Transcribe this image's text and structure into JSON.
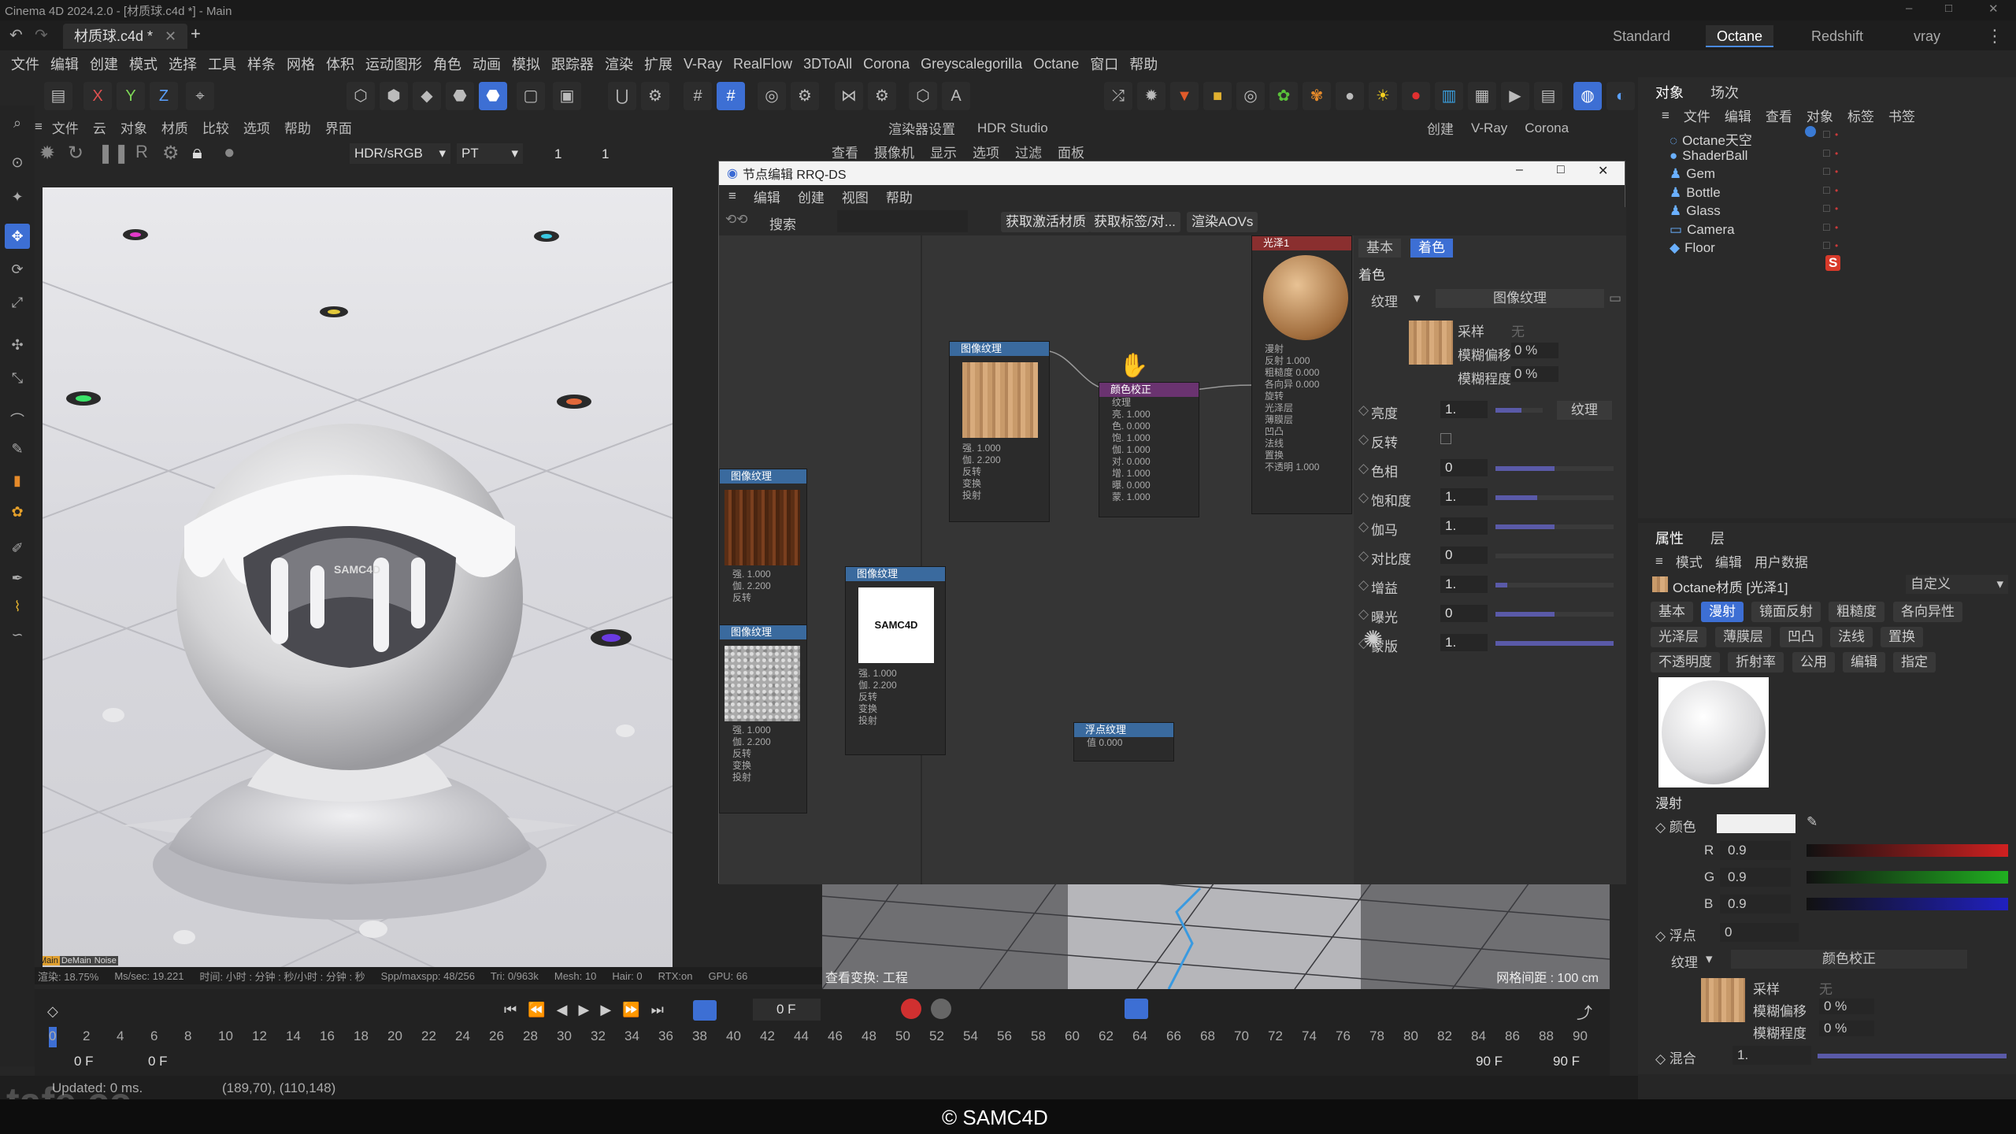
{
  "app": {
    "title": "Cinema 4D 2024.2.0 - [材质球.c4d *] - Main",
    "doc_tab": "材质球.c4d *",
    "add_tab": "+"
  },
  "layouts": [
    "Standard",
    "Octane",
    "Redshift",
    "vray"
  ],
  "menu": [
    "文件",
    "编辑",
    "创建",
    "模式",
    "选择",
    "工具",
    "样条",
    "网格",
    "体积",
    "运动图形",
    "角色",
    "动画",
    "模拟",
    "跟踪器",
    "渲染",
    "扩展",
    "V-Ray",
    "RealFlow",
    "3DToAll",
    "Corona",
    "Greyscalegorilla",
    "Octane",
    "窗口",
    "帮助"
  ],
  "toolbar_axes": [
    "X",
    "Y",
    "Z"
  ],
  "viewport": {
    "menu": [
      "文件",
      "云",
      "对象",
      "材质",
      "比较",
      "选项",
      "帮助",
      "界面"
    ],
    "color_space": "HDR/sRGB",
    "render_mode": "PT",
    "field1": "1",
    "field2": "1",
    "labels": [
      "Main",
      "DeMain",
      "Noise"
    ],
    "status": [
      "渲染: 18.75%",
      "Ms/sec: 19.221",
      "时间: 小时 : 分钟 : 秒/小时 : 分钟 : 秒",
      "Spp/maxspp: 48/256",
      "Tri: 0/963k",
      "Mesh: 10",
      "Hair: 0",
      "RTX:on",
      "GPU: 66"
    ],
    "logo_text": "SAMC4D"
  },
  "midmenu": {
    "left": [
      "渲染器设置",
      "HDR Studio"
    ],
    "right": [
      "创建",
      "V-Ray",
      "Corona"
    ],
    "view": [
      "查看",
      "摄像机",
      "显示",
      "选项",
      "过滤",
      "面板"
    ]
  },
  "node_editor": {
    "title": "节点编辑 RRQ-DS",
    "menu": [
      "编辑",
      "创建",
      "视图",
      "帮助"
    ],
    "search": "搜索",
    "buttons": [
      "获取激活材质",
      "获取标签/对...",
      "渲染AOVs"
    ],
    "nodes": {
      "img1": {
        "title": "图像纹理",
        "rows": [
          "强.  1.000",
          "伽.  2.200",
          "反转",
          "变换",
          "投射"
        ]
      },
      "img2": {
        "title": "图像纹理",
        "rows": [
          "强.  1.000",
          "伽.  2.200",
          "反转",
          "变换",
          "投射"
        ],
        "swatch_text": "SAMC4D"
      },
      "img3": {
        "title": "图像纹理",
        "rows": [
          "强.  1.000",
          "伽.  2.200",
          "反转"
        ]
      },
      "img4": {
        "title": "图像纹理",
        "rows": [
          "强.  1.000",
          "伽.  2.200",
          "反转",
          "变换",
          "投射"
        ]
      },
      "cc": {
        "title": "颜色校正",
        "rows": [
          "纹理",
          "亮.  1.000",
          "色.  0.000",
          "饱.  1.000",
          "伽.  1.000",
          "对.  0.000",
          "增.  1.000",
          "曝.  0.000",
          "蒙.  1.000"
        ]
      },
      "glossy": {
        "title": "光泽1",
        "rows": [
          "漫射",
          "反射  1.000",
          "粗糙度  0.000",
          "各向异  0.000",
          "旋转",
          "光泽层",
          "薄膜层",
          "凹凸",
          "法线",
          "置换",
          "不透明  1.000"
        ]
      },
      "float": {
        "title": "浮点纹理",
        "rows": [
          "值  0.000"
        ]
      }
    },
    "inspector": {
      "tabs": [
        "基本",
        "着色"
      ],
      "section": "着色",
      "texture_label": "纹理",
      "texture_value": "图像纹理",
      "sampling": "采样",
      "sampling_val": "无",
      "blur_offset": "模糊偏移",
      "blur_offset_val": "0 %",
      "blur_degree": "模糊程度",
      "blur_degree_val": "0 %",
      "params": [
        {
          "label": "亮度",
          "value": "1.",
          "fill": 0.55
        },
        {
          "label": "反转",
          "value": "",
          "fill": 0
        },
        {
          "label": "色相",
          "value": "0",
          "fill": 0.5
        },
        {
          "label": "饱和度",
          "value": "1.",
          "fill": 0.35
        },
        {
          "label": "伽马",
          "value": "1.",
          "fill": 0.5
        },
        {
          "label": "对比度",
          "value": "0",
          "fill": 0.0
        },
        {
          "label": "增益",
          "value": "1.",
          "fill": 0.1
        },
        {
          "label": "曝光",
          "value": "0",
          "fill": 0.5
        },
        {
          "label": "蒙版",
          "value": "1.",
          "fill": 1.0
        }
      ],
      "tex_button": "纹理"
    }
  },
  "bottom_view": {
    "left": "查看变换: 工程",
    "right": "网格间距 : 100 cm"
  },
  "timeline": {
    "frame": "0 F",
    "ticks": [
      "0",
      "2",
      "4",
      "6",
      "8",
      "10",
      "12",
      "14",
      "16",
      "18",
      "20",
      "22",
      "24",
      "26",
      "28",
      "30",
      "32",
      "34",
      "36",
      "38",
      "40",
      "42",
      "44",
      "46",
      "48",
      "50",
      "52",
      "54",
      "56",
      "58",
      "60",
      "62",
      "64",
      "66",
      "68",
      "70",
      "72",
      "74",
      "76",
      "78",
      "80",
      "82",
      "84",
      "86",
      "88",
      "90"
    ],
    "start": "0 F",
    "start2": "0 F",
    "end": "90 F",
    "end2": "90 F"
  },
  "status": {
    "updated": "Updated: 0 ms.",
    "coords": "(189,70), (110,148)"
  },
  "footer": "© SAMC4D",
  "watermark": "tafe.cc",
  "objects_panel": {
    "tabs": [
      "对象",
      "场次"
    ],
    "menu": [
      "文件",
      "编辑",
      "查看",
      "对象",
      "标签",
      "书签"
    ],
    "items": [
      "Octane天空",
      "ShaderBall",
      "Gem",
      "Bottle",
      "Glass",
      "Camera",
      "Floor"
    ]
  },
  "attr_panel": {
    "tabs": [
      "属性",
      "层"
    ],
    "menu": [
      "模式",
      "编辑",
      "用户数据"
    ],
    "material": "Octane材质 [光泽1]",
    "preset": "自定义",
    "tabs_row1": [
      "基本",
      "漫射",
      "镜面反射",
      "粗糙度",
      "各向异性"
    ],
    "tabs_row2": [
      "光泽层",
      "薄膜层",
      "凹凸",
      "法线",
      "置换"
    ],
    "tabs_row3": [
      "不透明度",
      "折射率",
      "公用",
      "编辑",
      "指定"
    ],
    "section": "漫射",
    "color_label": "颜色",
    "rgb": [
      {
        "ch": "R",
        "val": "0.9"
      },
      {
        "ch": "G",
        "val": "0.9"
      },
      {
        "ch": "B",
        "val": "0.9"
      }
    ],
    "float_label": "浮点",
    "float_val": "0",
    "texture_label": "纹理",
    "texture_value": "颜色校正",
    "sampling": "采样",
    "sampling_val": "无",
    "blur_offset": "模糊偏移",
    "blur_offset_val": "0 %",
    "blur_degree": "模糊程度",
    "blur_degree_val": "0 %",
    "mix_label": "混合",
    "mix_val": "1."
  }
}
